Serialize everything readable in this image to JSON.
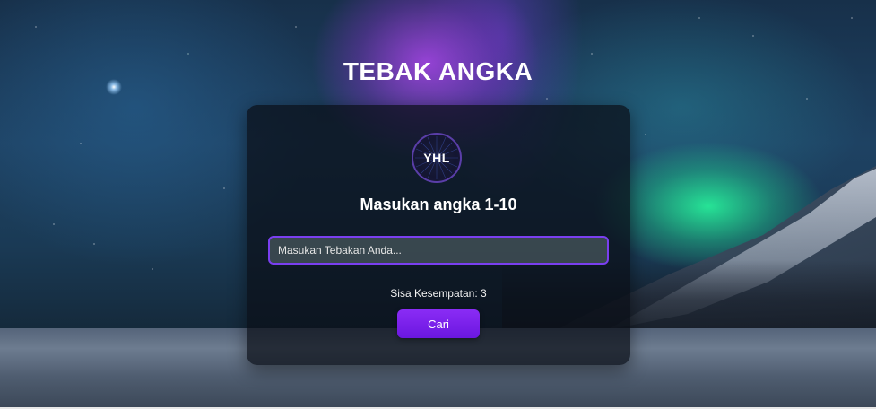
{
  "page": {
    "title": "TEBAK ANGKA"
  },
  "card": {
    "logo_text": "YHL",
    "subtitle": "Masukan angka 1-10",
    "input": {
      "placeholder": "Masukan Tebakan Anda...",
      "value": ""
    },
    "remaining_label": "Sisa Kesempatan:",
    "remaining_count": "3",
    "button_label": "Cari"
  },
  "colors": {
    "accent": "#7a3ff0",
    "button": "#7a22ea",
    "card_bg": "#0a0e16"
  }
}
